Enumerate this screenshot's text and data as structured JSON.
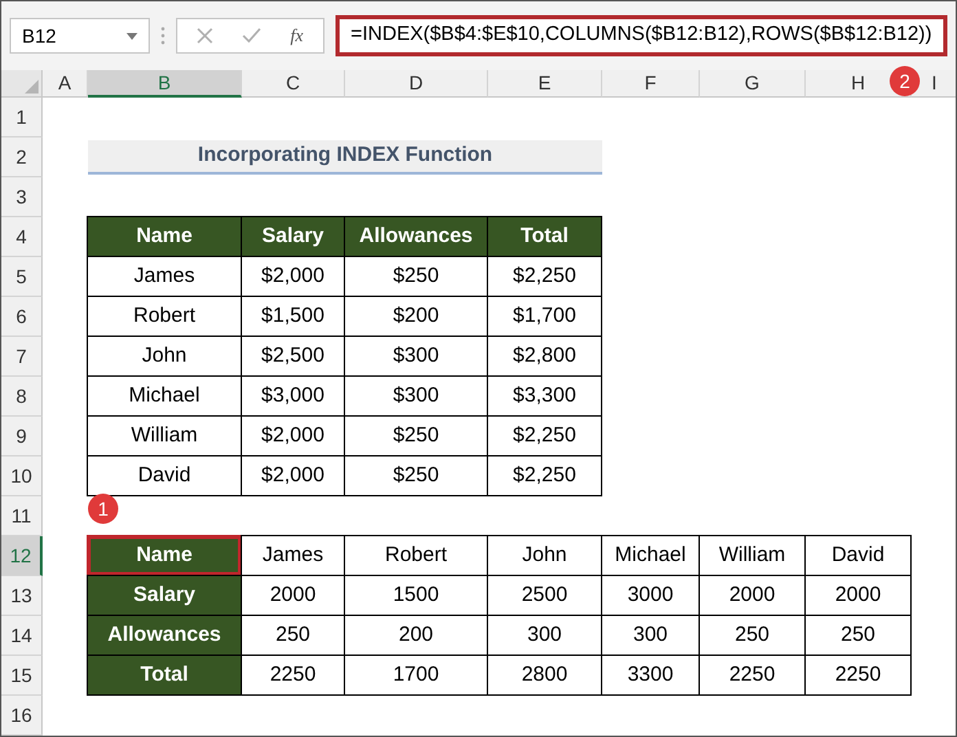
{
  "name_box": "B12",
  "formula_button": "fx",
  "formula": "=INDEX($B$4:$E$10,COLUMNS($B12:B12),ROWS($B$12:B12))",
  "columns": [
    {
      "label": "A",
      "selected": false
    },
    {
      "label": "B",
      "selected": true
    },
    {
      "label": "C",
      "selected": false
    },
    {
      "label": "D",
      "selected": false
    },
    {
      "label": "E",
      "selected": false
    },
    {
      "label": "F",
      "selected": false
    },
    {
      "label": "G",
      "selected": false
    },
    {
      "label": "H",
      "selected": false
    },
    {
      "label": "I",
      "selected": false
    }
  ],
  "rows": [
    {
      "label": "1",
      "selected": false
    },
    {
      "label": "2",
      "selected": false
    },
    {
      "label": "3",
      "selected": false
    },
    {
      "label": "4",
      "selected": false
    },
    {
      "label": "5",
      "selected": false
    },
    {
      "label": "6",
      "selected": false
    },
    {
      "label": "7",
      "selected": false
    },
    {
      "label": "8",
      "selected": false
    },
    {
      "label": "9",
      "selected": false
    },
    {
      "label": "10",
      "selected": false
    },
    {
      "label": "11",
      "selected": false
    },
    {
      "label": "12",
      "selected": true
    },
    {
      "label": "13",
      "selected": false
    },
    {
      "label": "14",
      "selected": false
    },
    {
      "label": "15",
      "selected": false
    },
    {
      "label": "16",
      "selected": false
    }
  ],
  "title": "Incorporating INDEX Function",
  "source_table": {
    "headers": [
      "Name",
      "Salary",
      "Allowances",
      "Total"
    ],
    "rows": [
      [
        "James",
        "$2,000",
        "$250",
        "$2,250"
      ],
      [
        "Robert",
        "$1,500",
        "$200",
        "$1,700"
      ],
      [
        "John",
        "$2,500",
        "$300",
        "$2,800"
      ],
      [
        "Michael",
        "$3,000",
        "$300",
        "$3,300"
      ],
      [
        "William",
        "$2,000",
        "$250",
        "$2,250"
      ],
      [
        "David",
        "$2,000",
        "$250",
        "$2,250"
      ]
    ]
  },
  "result_table": {
    "rows": [
      {
        "header": "Name",
        "selected": true,
        "values": [
          "James",
          "Robert",
          "John",
          "Michael",
          "William",
          "David"
        ]
      },
      {
        "header": "Salary",
        "selected": false,
        "values": [
          "2000",
          "1500",
          "2500",
          "3000",
          "2000",
          "2000"
        ]
      },
      {
        "header": "Allowances",
        "selected": false,
        "values": [
          "250",
          "200",
          "300",
          "300",
          "250",
          "250"
        ]
      },
      {
        "header": "Total",
        "selected": false,
        "values": [
          "2250",
          "1700",
          "2800",
          "3300",
          "2250",
          "2250"
        ]
      }
    ]
  },
  "callouts": [
    "1",
    "2"
  ]
}
